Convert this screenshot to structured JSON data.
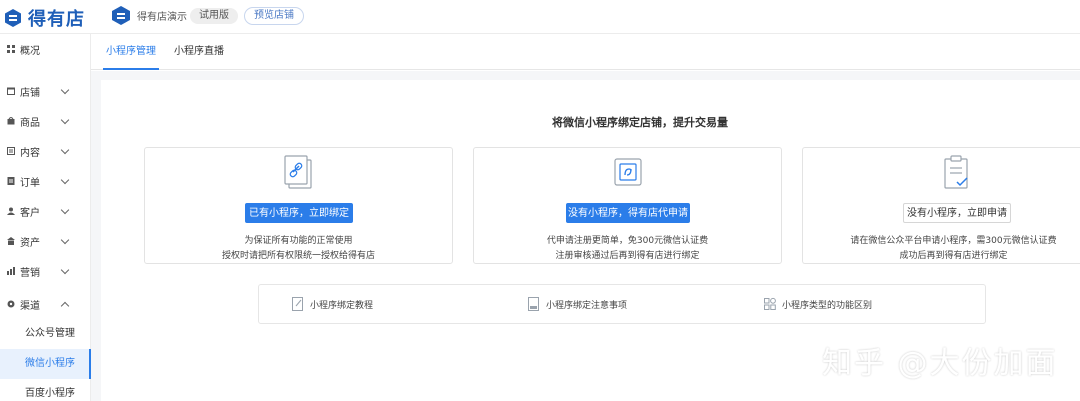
{
  "header": {
    "logo_text": "得有店",
    "store_name": "得有店演示",
    "trial_badge": "试用版",
    "preview_button": "预览店铺"
  },
  "sidebar": {
    "items": [
      {
        "label": "概况",
        "icon": "dashboard-icon"
      },
      {
        "label": "店铺",
        "icon": "store-icon"
      },
      {
        "label": "商品",
        "icon": "goods-icon"
      },
      {
        "label": "内容",
        "icon": "content-icon"
      },
      {
        "label": "订单",
        "icon": "order-icon"
      },
      {
        "label": "客户",
        "icon": "customer-icon"
      },
      {
        "label": "资产",
        "icon": "asset-icon"
      },
      {
        "label": "营销",
        "icon": "marketing-icon"
      },
      {
        "label": "渠道",
        "icon": "channel-icon"
      }
    ],
    "sub_items": [
      {
        "label": "公众号管理"
      },
      {
        "label": "微信小程序"
      },
      {
        "label": "百度小程序"
      }
    ]
  },
  "tabs": [
    {
      "label": "小程序管理"
    },
    {
      "label": "小程序直播"
    }
  ],
  "main": {
    "headline": "将微信小程序绑定店铺，提升交易量",
    "cards": [
      {
        "button": "已有小程序，立即绑定",
        "line1": "为保证所有功能的正常使用",
        "line2": "授权时请把所有权限统一授权给得有店",
        "icon": "link-document-icon"
      },
      {
        "button": "没有小程序，得有店代申请",
        "line1": "代申请注册更简单，免300元微信认证费",
        "line2": "注册审核通过后再到得有店进行绑定",
        "icon": "mini-program-icon"
      },
      {
        "button": "没有小程序，立即申请",
        "line1": "请在微信公众平台申请小程序，需300元微信认证费",
        "line2": "成功后再到得有店进行绑定",
        "icon": "clipboard-check-icon"
      }
    ],
    "help_links": [
      {
        "label": "小程序绑定教程",
        "icon": "edit-doc-icon"
      },
      {
        "label": "小程序绑定注意事项",
        "icon": "notice-doc-icon"
      },
      {
        "label": "小程序类型的功能区别",
        "icon": "apps-grid-icon"
      }
    ]
  },
  "watermark": "知乎 @大份加面",
  "colors": {
    "accent": "#2b7de9",
    "brand": "#1f5fb8",
    "active_bg": "#e8f1fd"
  }
}
